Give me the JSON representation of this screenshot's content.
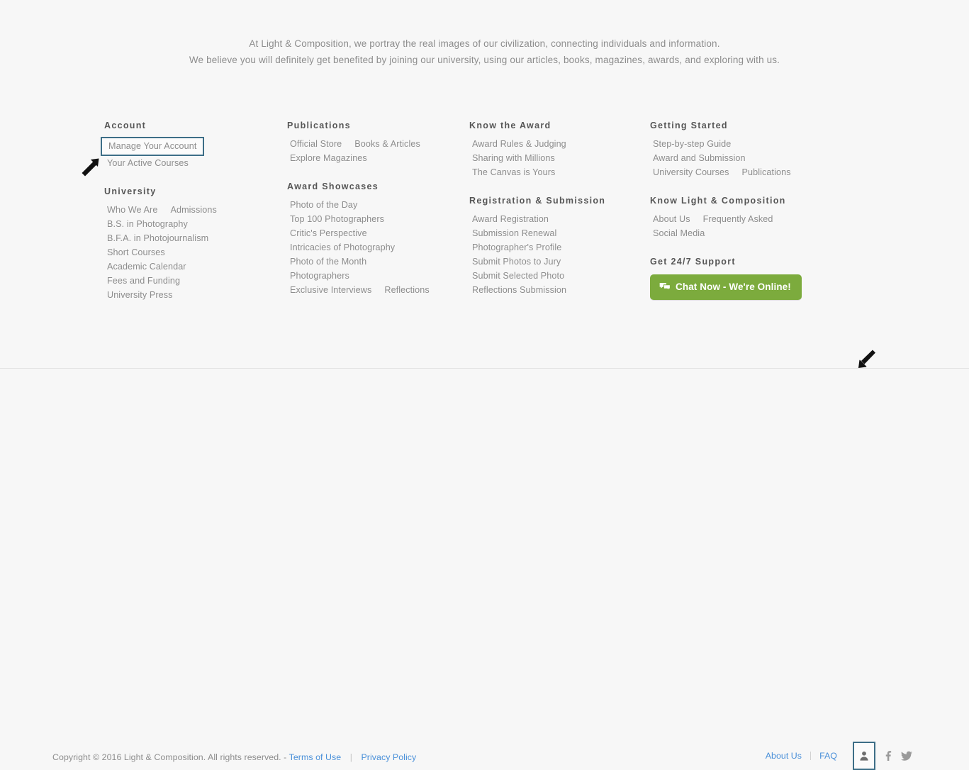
{
  "intro": {
    "line1": "At Light & Composition, we portray the real images of our civilization, connecting individuals and information.",
    "line2": "We believe you will definitely get benefited by joining our university, using our articles, books, magazines, awards, and exploring with us."
  },
  "colors": {
    "page_background": "#f7f7f7",
    "heading": "#565656",
    "link": "#8d8d8d",
    "link_blue": "#4a90d9",
    "highlight_border": "#3d6e87",
    "chat_button_green": "#7cab3d",
    "divider": "#e3e3e3"
  },
  "columns": [
    {
      "groups": [
        {
          "title": "Account",
          "rows": [
            {
              "items": [
                "Manage Your Account"
              ],
              "highlight": true
            },
            {
              "items": [
                "Your Active Courses"
              ]
            }
          ]
        },
        {
          "title": "University",
          "rows": [
            {
              "items": [
                "Who We Are",
                "Admissions"
              ]
            },
            {
              "items": [
                "B.S. in Photography"
              ]
            },
            {
              "items": [
                "B.F.A. in Photojournalism"
              ]
            },
            {
              "items": [
                "Short Courses"
              ]
            },
            {
              "items": [
                "Academic Calendar"
              ]
            },
            {
              "items": [
                "Fees and Funding"
              ]
            },
            {
              "items": [
                "University Press"
              ]
            }
          ]
        }
      ]
    },
    {
      "groups": [
        {
          "title": "Publications",
          "rows": [
            {
              "items": [
                "Official Store",
                "Books & Articles"
              ]
            },
            {
              "items": [
                "Explore Magazines"
              ]
            }
          ]
        },
        {
          "title": "Award Showcases",
          "rows": [
            {
              "items": [
                "Photo of the Day"
              ]
            },
            {
              "items": [
                "Top 100 Photographers"
              ]
            },
            {
              "items": [
                "Critic's Perspective"
              ]
            },
            {
              "items": [
                "Intricacies of Photography"
              ]
            },
            {
              "items": [
                "Photo of the Month"
              ]
            },
            {
              "items": [
                "Photographers"
              ]
            },
            {
              "items": [
                "Exclusive Interviews",
                "Reflections"
              ]
            }
          ]
        }
      ]
    },
    {
      "groups": [
        {
          "title": "Know the Award",
          "rows": [
            {
              "items": [
                "Award Rules & Judging"
              ]
            },
            {
              "items": [
                "Sharing with Millions"
              ]
            },
            {
              "items": [
                "The Canvas is Yours"
              ]
            }
          ]
        },
        {
          "title": "Registration & Submission",
          "rows": [
            {
              "items": [
                "Award Registration"
              ]
            },
            {
              "items": [
                "Submission Renewal"
              ]
            },
            {
              "items": [
                "Photographer's Profile"
              ]
            },
            {
              "items": [
                "Submit Photos to Jury"
              ]
            },
            {
              "items": [
                "Submit Selected Photo"
              ]
            },
            {
              "items": [
                "Reflections Submission"
              ]
            }
          ]
        }
      ]
    },
    {
      "groups": [
        {
          "title": "Getting Started",
          "rows": [
            {
              "items": [
                "Step-by-step Guide"
              ]
            },
            {
              "items": [
                "Award and Submission"
              ]
            },
            {
              "items": [
                "University Courses",
                "Publications"
              ]
            }
          ]
        },
        {
          "title": "Know Light & Composition",
          "rows": [
            {
              "items": [
                "About Us",
                "Frequently Asked"
              ]
            },
            {
              "items": [
                "Social Media"
              ]
            }
          ]
        }
      ],
      "support": {
        "title": "Get 24/7 Support",
        "chat_button_label": "Chat Now - We're Online!",
        "chat_icon": "chat-bubbles-icon"
      }
    }
  ],
  "footer": {
    "copyright_text": "Copyright © 2016 Light & Composition. All rights reserved. -",
    "terms_label": "Terms of Use",
    "separator": "|",
    "privacy_label": "Privacy Policy",
    "about_label": "About Us",
    "faq_label": "FAQ",
    "social": [
      {
        "name": "user-profile-icon",
        "highlight": true
      },
      {
        "name": "facebook-icon",
        "glyph": "f"
      },
      {
        "name": "twitter-icon"
      }
    ]
  },
  "annotations": [
    {
      "name": "arrow-up-right",
      "target": "account-links"
    },
    {
      "name": "arrow-down-left",
      "target": "user-profile-icon"
    }
  ]
}
